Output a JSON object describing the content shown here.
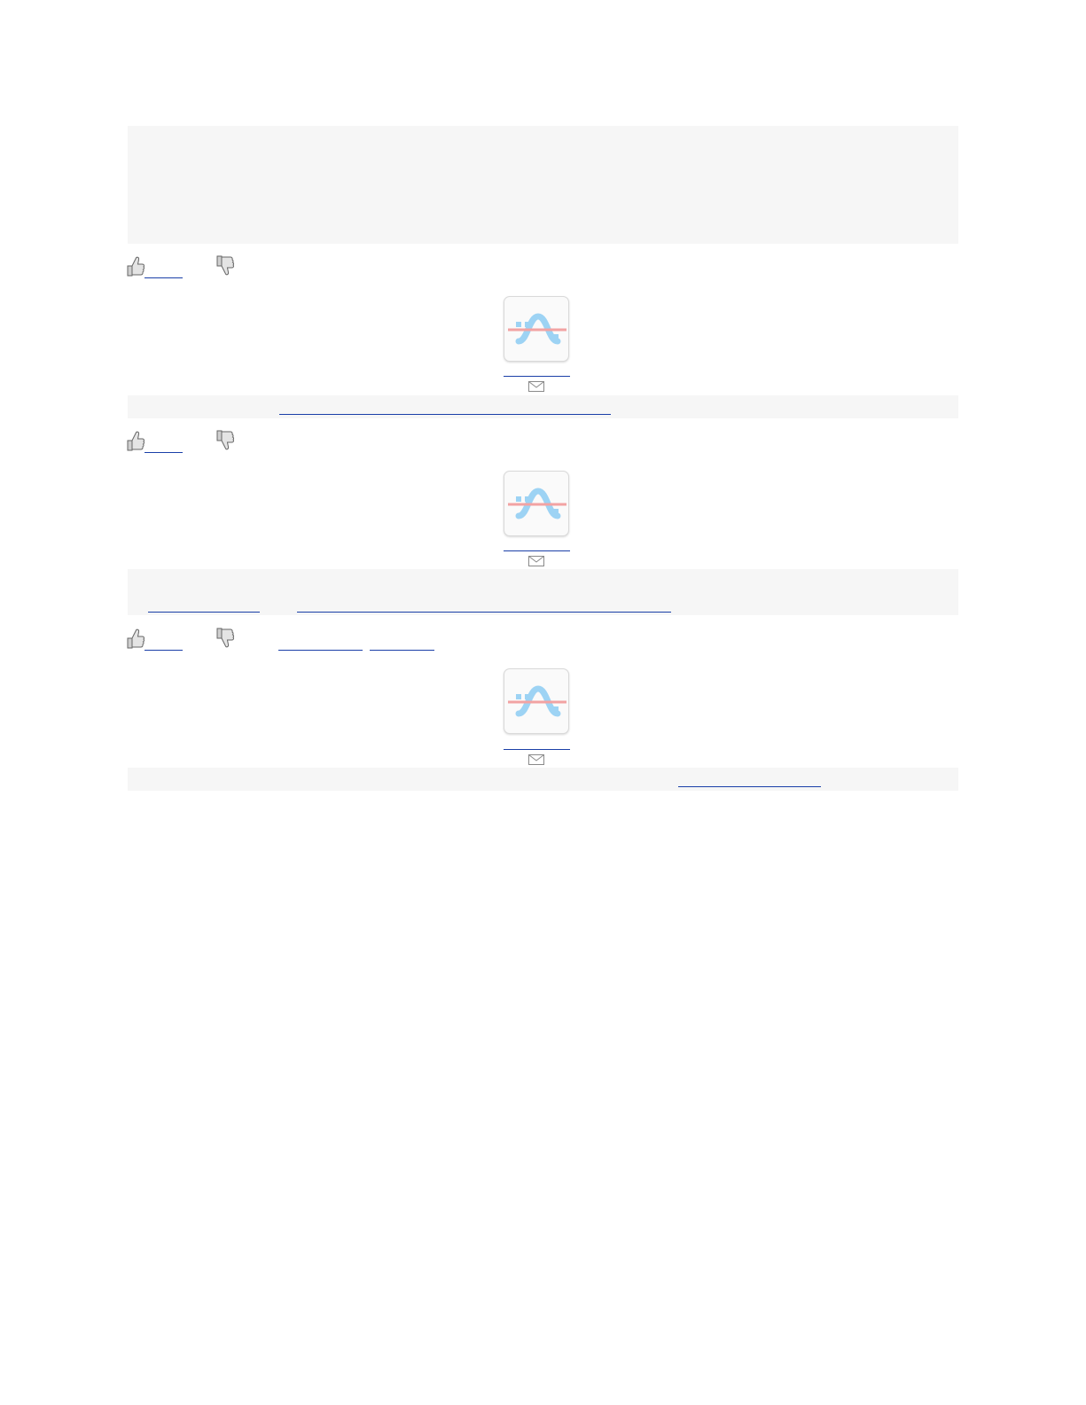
{
  "colors": {
    "band_background": "#f6f6f6",
    "link_underline": "#1a3fa8",
    "avatar_blue": "#9dd3f4",
    "avatar_red": "#f2a3a3"
  },
  "posts": [
    {
      "like_icon": "thumbs-up-icon",
      "dislike_icon": "thumbs-down-icon",
      "avatar_icon": "wave-chart-avatar-icon",
      "mail_icon": "envelope-icon"
    },
    {
      "like_icon": "thumbs-up-icon",
      "dislike_icon": "thumbs-down-icon",
      "avatar_icon": "wave-chart-avatar-icon",
      "mail_icon": "envelope-icon"
    },
    {
      "like_icon": "thumbs-up-icon",
      "dislike_icon": "thumbs-down-icon",
      "avatar_icon": "wave-chart-avatar-icon",
      "mail_icon": "envelope-icon"
    }
  ]
}
